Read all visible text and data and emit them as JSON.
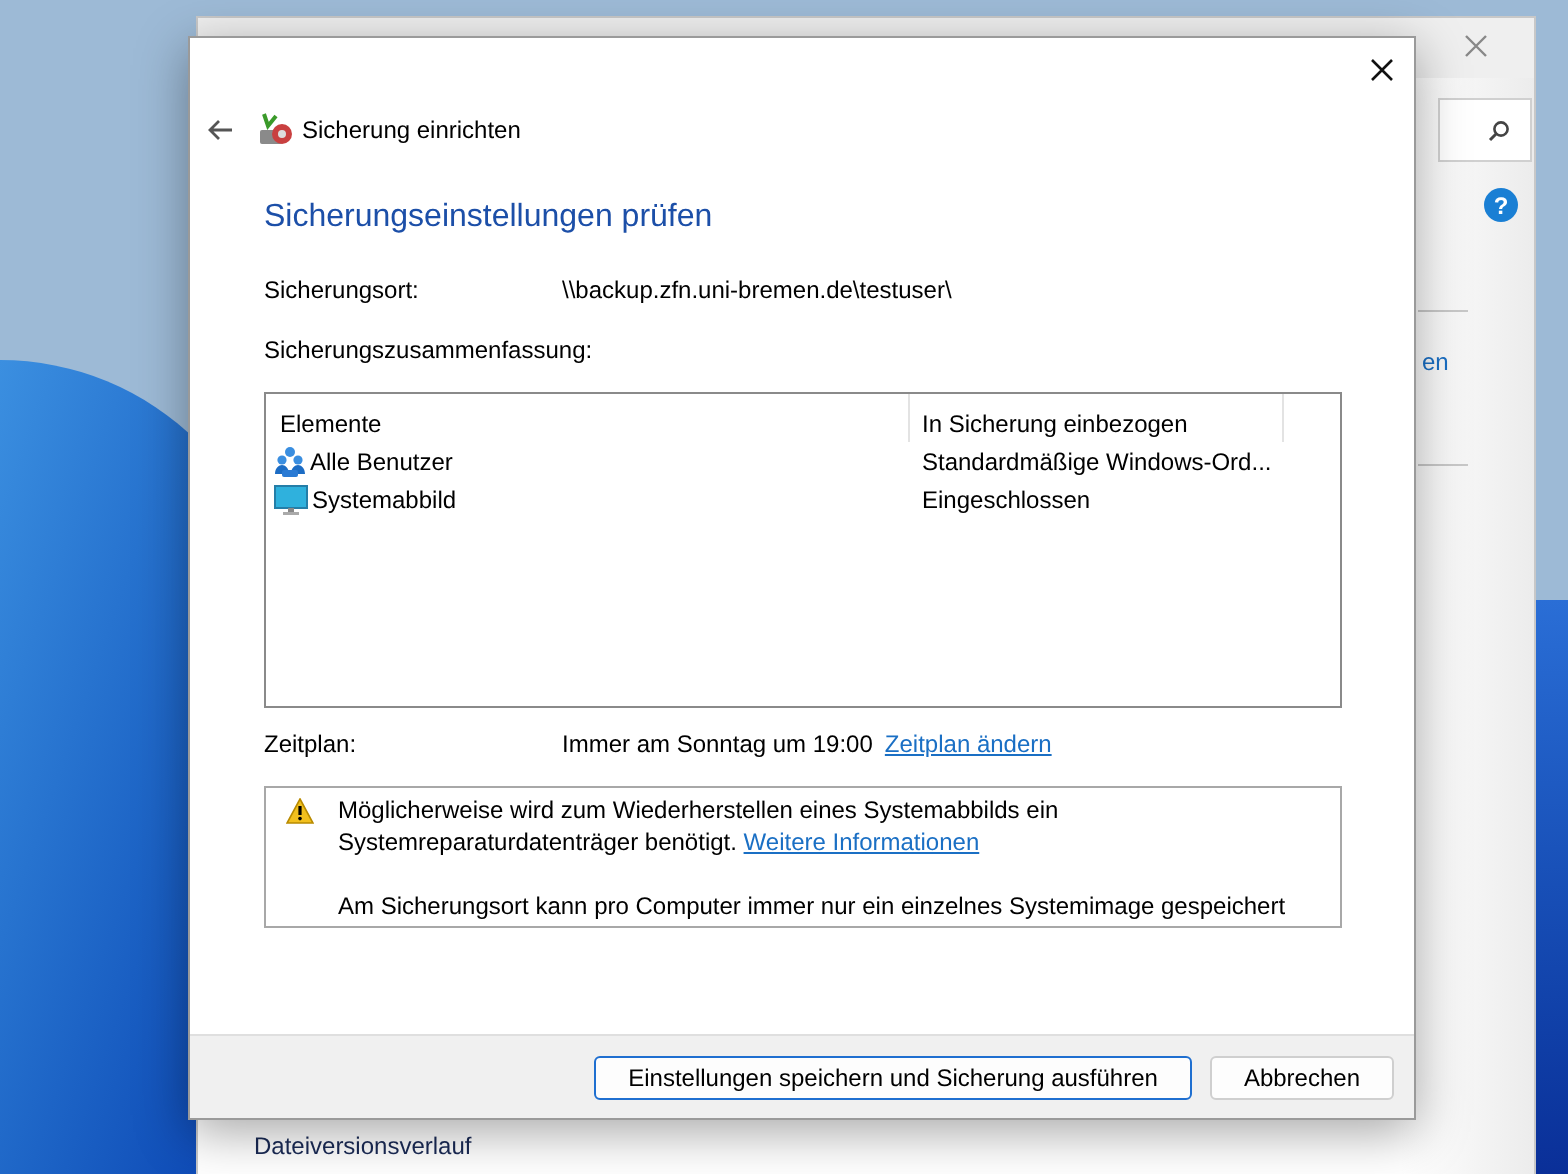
{
  "background_window": {
    "help_icon": "?",
    "partial_link": "en",
    "footer_item": "Dateiversionsverlauf"
  },
  "dialog": {
    "header_title": "Sicherung einrichten",
    "heading": "Sicherungseinstellungen prüfen",
    "location_label": "Sicherungsort:",
    "location_value": "\\\\backup.zfn.uni-bremen.de\\testuser\\",
    "summary_label": "Sicherungszusammenfassung:",
    "table": {
      "columns": [
        "Elemente",
        "In Sicherung einbezogen"
      ],
      "rows": [
        {
          "kind": "users",
          "name": "Alle Benutzer",
          "value": "Standardmäßige Windows-Ord..."
        },
        {
          "kind": "system",
          "name": "Systemabbild",
          "value": "Eingeschlossen"
        }
      ]
    },
    "schedule": {
      "label": "Zeitplan:",
      "value": "Immer am Sonntag um 19:00",
      "link": "Zeitplan ändern"
    },
    "notice": {
      "text": "Möglicherweise wird zum Wiederherstellen eines Systemabbilds ein Systemreparaturdatenträger benötigt.",
      "link": "Weitere Informationen",
      "text_2": "Am Sicherungsort kann pro Computer immer nur ein einzelnes Systemimage gespeichert"
    },
    "buttons": [
      {
        "label": "Einstellungen speichern und Sicherung ausführen",
        "default": true
      },
      {
        "label": "Abbrechen",
        "default": false
      }
    ]
  }
}
